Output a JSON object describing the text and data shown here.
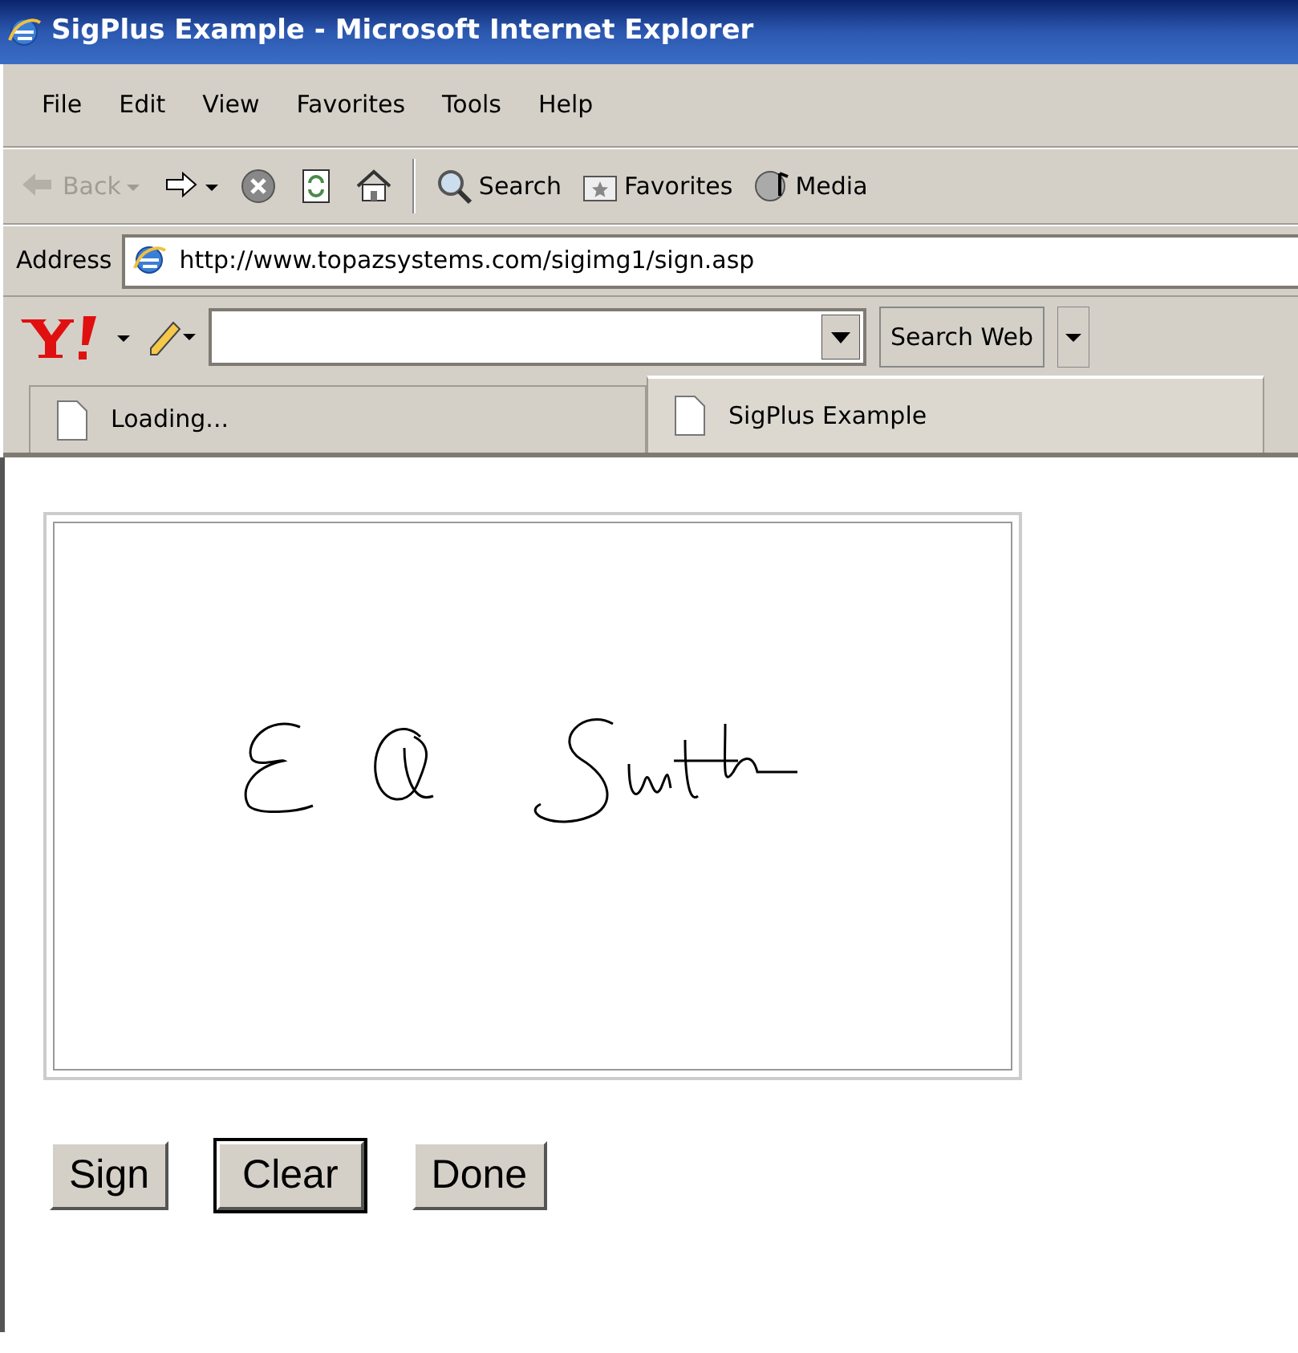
{
  "window": {
    "title": "SigPlus Example - Microsoft Internet Explorer"
  },
  "menu": [
    "File",
    "Edit",
    "View",
    "Favorites",
    "Tools",
    "Help"
  ],
  "toolbar": [
    {
      "kind": "back",
      "label": "Back",
      "disabled": true
    },
    {
      "kind": "forward",
      "disabled": false
    },
    {
      "kind": "stop",
      "disabled": false
    },
    {
      "kind": "refresh",
      "disabled": false
    },
    {
      "kind": "home",
      "disabled": false
    },
    {
      "kind": "search",
      "label": "Search",
      "disabled": false
    },
    {
      "kind": "favorites",
      "label": "Favorites",
      "disabled": false
    },
    {
      "kind": "media",
      "label": "Media",
      "disabled": false
    }
  ],
  "address": {
    "label": "Address",
    "url": "http://www.topazsystems.com/sigimg1/sign.asp"
  },
  "yahoo_bar": {
    "search_button": "Search Web"
  },
  "tabs": [
    {
      "label": "Loading...",
      "selected": false
    },
    {
      "label": "SigPlus Example",
      "selected": true
    }
  ],
  "buttons": [
    {
      "label": "Sign",
      "focused": false
    },
    {
      "label": "Clear",
      "focused": true
    },
    {
      "label": "Done",
      "focused": false
    }
  ]
}
